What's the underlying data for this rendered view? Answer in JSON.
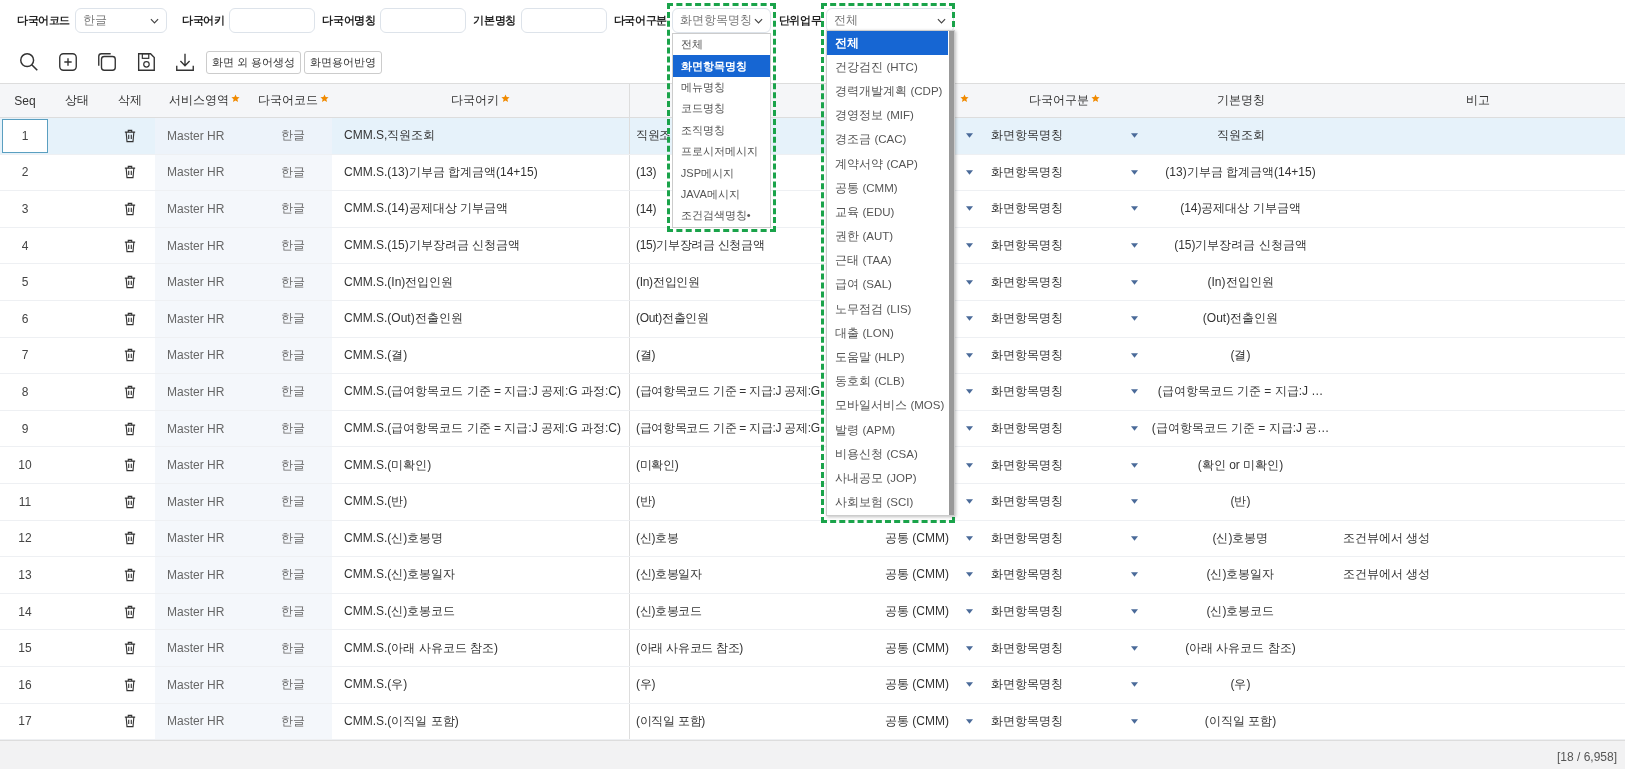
{
  "filters": [
    {
      "kind": "select",
      "label": "다국어코드",
      "value": "한글"
    },
    {
      "kind": "input",
      "label": "다국어키"
    },
    {
      "kind": "input",
      "label": "다국어명칭"
    },
    {
      "kind": "input",
      "label": "기본명칭"
    },
    {
      "kind": "select",
      "label": "다국어구분",
      "value": "화면항목명칭",
      "open": true,
      "highlighted": true,
      "options": [
        {
          "label": "전체",
          "selected": false
        },
        {
          "label": "화면항목명칭",
          "selected": true
        },
        {
          "label": "메뉴명칭",
          "selected": false
        },
        {
          "label": "코드명칭",
          "selected": false
        },
        {
          "label": "조직명칭",
          "selected": false
        },
        {
          "label": "프로시저메시지",
          "selected": false
        },
        {
          "label": "JSP메시지",
          "selected": false
        },
        {
          "label": "JAVA메시지",
          "selected": false
        },
        {
          "label": "조건검색명칭•",
          "selected": false
        }
      ]
    },
    {
      "kind": "select",
      "label": "단위업무",
      "value": "전체",
      "open": true,
      "highlighted": true,
      "options": [
        {
          "label": "전체",
          "selected": true
        },
        {
          "label": "건강검진 (HTC)",
          "selected": false
        },
        {
          "label": "경력개발계획 (CDP)",
          "selected": false
        },
        {
          "label": "경영정보 (MIF)",
          "selected": false
        },
        {
          "label": "경조금 (CAC)",
          "selected": false
        },
        {
          "label": "계약서약 (CAP)",
          "selected": false
        },
        {
          "label": "공통 (CMM)",
          "selected": false
        },
        {
          "label": "교육 (EDU)",
          "selected": false
        },
        {
          "label": "권한 (AUT)",
          "selected": false
        },
        {
          "label": "근태 (TAA)",
          "selected": false
        },
        {
          "label": "급여 (SAL)",
          "selected": false
        },
        {
          "label": "노무점검 (LIS)",
          "selected": false
        },
        {
          "label": "대출 (LON)",
          "selected": false
        },
        {
          "label": "도움말 (HLP)",
          "selected": false
        },
        {
          "label": "동호회 (CLB)",
          "selected": false
        },
        {
          "label": "모바일서비스 (MOS)",
          "selected": false
        },
        {
          "label": "발령 (APM)",
          "selected": false
        },
        {
          "label": "비용신청 (CSA)",
          "selected": false
        },
        {
          "label": "사내공모 (JOP)",
          "selected": false
        },
        {
          "label": "사회보험 (SCI)",
          "selected": false
        }
      ]
    }
  ],
  "toolbar_buttons": [
    "화면 외 용어생성",
    "화면용어반영"
  ],
  "table": {
    "columns": [
      {
        "label": "Seq",
        "required": false
      },
      {
        "label": "상태",
        "required": false
      },
      {
        "label": "삭제",
        "required": false
      },
      {
        "label": "서비스영역",
        "required": true
      },
      {
        "label": "다국어코드",
        "required": true
      },
      {
        "label": "다국어키",
        "required": true
      },
      {},
      {
        "required": true
      },
      {
        "label": "다국어구분",
        "required": true
      },
      {
        "label": "기본명칭",
        "required": false
      },
      {
        "label": "비고",
        "required": false
      }
    ],
    "rows": [
      {
        "seq": "1",
        "selected": true,
        "service": "Master HR",
        "code": "한글",
        "key": "CMM.S,직원조회",
        "name": "직원조",
        "category": "화면항목명칭",
        "base": "직원조회"
      },
      {
        "seq": "2",
        "selected": false,
        "service": "Master HR",
        "code": "한글",
        "key": "CMM.S.(13)기부금 합계금액(14+15)",
        "name": "(13)",
        "category": "화면항목명칭",
        "base": "(13)기부금 합계금액(14+15)"
      },
      {
        "seq": "3",
        "selected": false,
        "service": "Master HR",
        "code": "한글",
        "key": "CMM.S.(14)공제대상 기부금액",
        "name": "(14)",
        "category": "화면항목명칭",
        "base": "(14)공제대상 기부금액"
      },
      {
        "seq": "4",
        "selected": false,
        "service": "Master HR",
        "code": "한글",
        "key": "CMM.S.(15)기부장려금 신청금액",
        "name": "(15)기부장려금 신청금액",
        "category": "화면항목명칭",
        "base": "(15)기부장려금 신청금액"
      },
      {
        "seq": "5",
        "selected": false,
        "service": "Master HR",
        "code": "한글",
        "key": "CMM.S.(In)전입인원",
        "name": "(In)전입인원",
        "category": "화면항목명칭",
        "base": "(In)전입인원"
      },
      {
        "seq": "6",
        "selected": false,
        "service": "Master HR",
        "code": "한글",
        "key": "CMM.S.(Out)전출인원",
        "name": "(Out)전출인원",
        "category": "화면항목명칭",
        "base": "(Out)전출인원"
      },
      {
        "seq": "7",
        "selected": false,
        "service": "Master HR",
        "code": "한글",
        "key": "CMM.S.(결)",
        "name": "(결)",
        "category": "화면항목명칭",
        "base": "(결)"
      },
      {
        "seq": "8",
        "selected": false,
        "service": "Master HR",
        "code": "한글",
        "key": "CMM.S.(급여항목코드 기준 = 지급:J  공제:G  과정:C)",
        "name": "(급여항목코드 기준 = 지급:J  공제:G",
        "category": "화면항목명칭",
        "base": "(급여항목코드 기준 = 지급:J  …"
      },
      {
        "seq": "9",
        "selected": false,
        "service": "Master HR",
        "code": "한글",
        "key": "CMM.S.(급여항목코드 기준 = 지급:J 공제:G 과정:C)",
        "name": "(급여항목코드 기준 = 지급:J 공제:G",
        "category": "화면항목명칭",
        "base": "(급여항목코드 기준 = 지급:J 공…"
      },
      {
        "seq": "10",
        "selected": false,
        "service": "Master HR",
        "code": "한글",
        "key": "CMM.S.(미확인)",
        "name": "(미확인)",
        "category": "화면항목명칭",
        "base": "(확인 or 미확인)"
      },
      {
        "seq": "11",
        "selected": false,
        "service": "Master HR",
        "code": "한글",
        "key": "CMM.S.(반)",
        "name": "(반)",
        "category": "화면항목명칭",
        "base": "(반)"
      },
      {
        "seq": "12",
        "selected": false,
        "service": "Master HR",
        "code": "한글",
        "key": "CMM.S.(신)호봉명",
        "name": "(신)호봉",
        "unit": "공통 (CMM)",
        "category": "화면항목명칭",
        "base": "(신)호봉명",
        "note": "조건뷰에서 생성"
      },
      {
        "seq": "13",
        "selected": false,
        "service": "Master HR",
        "code": "한글",
        "key": "CMM.S.(신)호봉일자",
        "name": "(신)호봉일자",
        "unit": "공통 (CMM)",
        "category": "화면항목명칭",
        "base": "(신)호봉일자",
        "note": "조건뷰에서 생성"
      },
      {
        "seq": "14",
        "selected": false,
        "service": "Master HR",
        "code": "한글",
        "key": "CMM.S.(신)호봉코드",
        "name": "(신)호봉코드",
        "unit": "공통 (CMM)",
        "category": "화면항목명칭",
        "base": "(신)호봉코드"
      },
      {
        "seq": "15",
        "selected": false,
        "service": "Master HR",
        "code": "한글",
        "key": "CMM.S.(아래 사유코드 참조)",
        "name": "(아래 사유코드 참조)",
        "unit": "공통 (CMM)",
        "category": "화면항목명칭",
        "base": "(아래 사유코드 참조)"
      },
      {
        "seq": "16",
        "selected": false,
        "service": "Master HR",
        "code": "한글",
        "key": "CMM.S.(우)",
        "name": "(우)",
        "unit": "공통 (CMM)",
        "category": "화면항목명칭",
        "base": "(우)"
      },
      {
        "seq": "17",
        "selected": false,
        "service": "Master HR",
        "code": "한글",
        "key": "CMM.S.(이직일 포함)",
        "name": "(이직일 포함)",
        "unit": "공통 (CMM)",
        "category": "화면항목명칭",
        "base": "(이직일 포함)"
      }
    ]
  },
  "status_bar": {
    "count": "[18 / 6,958]"
  }
}
